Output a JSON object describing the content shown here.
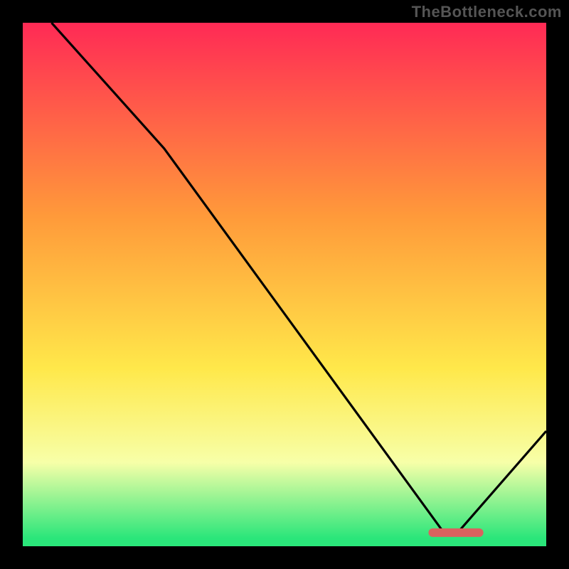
{
  "watermark": "TheBottleneck.com",
  "colors": {
    "top_red": "#ff2a55",
    "orange": "#ff9a3a",
    "yellow": "#ffe84a",
    "pale": "#f7ffa8",
    "green": "#2ae67a",
    "curve": "#000000",
    "marker": "#d9635f",
    "background": "#000000"
  },
  "chart_data": {
    "type": "line",
    "title": "",
    "xlabel": "",
    "ylabel": "",
    "xlim": [
      0,
      100
    ],
    "ylim": [
      0,
      100
    ],
    "curve": [
      {
        "x": 5.5,
        "y": 100
      },
      {
        "x": 27,
        "y": 76
      },
      {
        "x": 80,
        "y": 3.2
      },
      {
        "x": 83,
        "y": 2.5
      },
      {
        "x": 100,
        "y": 22
      }
    ],
    "optimum_marker": {
      "x_start": 77.5,
      "x_end": 88,
      "y": 2.6
    },
    "gradient_stops": [
      {
        "offset": 0.0,
        "key": "top_red"
      },
      {
        "offset": 0.37,
        "key": "orange"
      },
      {
        "offset": 0.66,
        "key": "yellow"
      },
      {
        "offset": 0.84,
        "key": "pale"
      },
      {
        "offset": 0.985,
        "key": "green"
      }
    ]
  }
}
